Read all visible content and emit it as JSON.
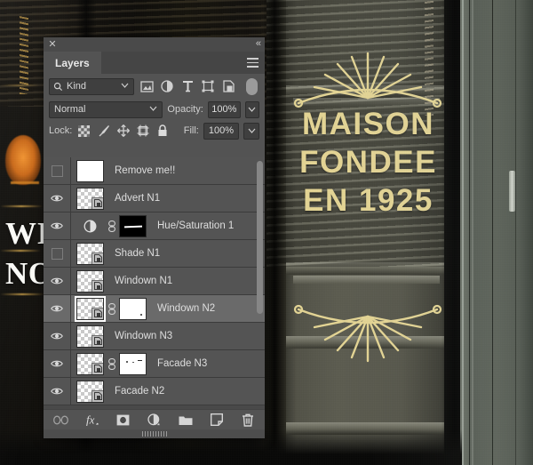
{
  "app": {
    "panel_title": "Layers",
    "close_icon": "close-icon",
    "collapse_icon": "double-chevron-left-icon",
    "menu_icon": "hamburger-menu-icon"
  },
  "filter_bar": {
    "kind_label": "Kind",
    "search_icon": "search-icon",
    "dropdown_icon": "chevron-down-icon",
    "filters": [
      {
        "name": "filter-pixel-layers",
        "icon": "image-icon"
      },
      {
        "name": "filter-adjustment-layers",
        "icon": "adjustment-circle-icon"
      },
      {
        "name": "filter-type-layers",
        "icon": "text-t-icon"
      },
      {
        "name": "filter-shape-layers",
        "icon": "shape-icon"
      },
      {
        "name": "filter-smart-objects",
        "icon": "smart-object-icon"
      }
    ],
    "toggle_name": "filter-enable-toggle"
  },
  "blend_bar": {
    "blend_mode": "Normal",
    "opacity_label": "Opacity:",
    "opacity_value": "100%",
    "dropdown_icon": "chevron-down-icon"
  },
  "lock_bar": {
    "lock_label": "Lock:",
    "fill_label": "Fill:",
    "fill_value": "100%",
    "locks": [
      {
        "name": "lock-transparent-pixels",
        "icon": "checkerboard-icon"
      },
      {
        "name": "lock-image-pixels",
        "icon": "brush-icon"
      },
      {
        "name": "lock-position",
        "icon": "move-arrows-icon"
      },
      {
        "name": "lock-artboard-nesting",
        "icon": "artboard-icon"
      },
      {
        "name": "lock-all",
        "icon": "padlock-icon"
      }
    ]
  },
  "layers": [
    {
      "name": "Remove me!!",
      "visible": false,
      "selected": false,
      "thumb": "white",
      "mask": null,
      "linked": false,
      "adjustment": false,
      "smart": false
    },
    {
      "name": "Advert N1",
      "visible": true,
      "selected": false,
      "thumb": "transparent",
      "mask": null,
      "linked": false,
      "adjustment": false,
      "smart": true
    },
    {
      "name": "Hue/Saturation 1",
      "visible": true,
      "selected": false,
      "thumb": "adjustment",
      "mask": "black",
      "linked": true,
      "adjustment": true,
      "smart": false
    },
    {
      "name": "Shade N1",
      "visible": false,
      "selected": false,
      "thumb": "transparent",
      "mask": null,
      "linked": false,
      "adjustment": false,
      "smart": true
    },
    {
      "name": "Windown N1",
      "visible": true,
      "selected": false,
      "thumb": "transparent",
      "mask": null,
      "linked": false,
      "adjustment": false,
      "smart": true
    },
    {
      "name": "Windown N2",
      "visible": true,
      "selected": true,
      "thumb": "transparent",
      "mask": "white",
      "linked": true,
      "adjustment": false,
      "smart": true
    },
    {
      "name": "Windown N3",
      "visible": true,
      "selected": false,
      "thumb": "transparent",
      "mask": null,
      "linked": false,
      "adjustment": false,
      "smart": true
    },
    {
      "name": "Facade N3",
      "visible": true,
      "selected": false,
      "thumb": "transparent",
      "mask": "white2",
      "linked": true,
      "adjustment": false,
      "smart": true
    },
    {
      "name": "Facade N2",
      "visible": true,
      "selected": false,
      "thumb": "transparent",
      "mask": null,
      "linked": false,
      "adjustment": false,
      "smart": true
    }
  ],
  "bottom_bar": {
    "buttons": [
      {
        "name": "link-layers-button",
        "icon": "link-icon"
      },
      {
        "name": "layer-style-button",
        "icon": "fx-icon"
      },
      {
        "name": "add-layer-mask-button",
        "icon": "mask-icon"
      },
      {
        "name": "new-adjustment-layer-button",
        "icon": "adjustment-circle-icon"
      },
      {
        "name": "new-group-button",
        "icon": "folder-icon"
      },
      {
        "name": "new-layer-button",
        "icon": "new-layer-icon"
      },
      {
        "name": "delete-layer-button",
        "icon": "trash-icon"
      }
    ]
  },
  "canvas": {
    "sign_lines": [
      "MAISON",
      "FONDEE",
      "EN 1925"
    ],
    "left_sign_lines": [
      "WI",
      "NO"
    ],
    "gold_color": "#e3d494"
  }
}
